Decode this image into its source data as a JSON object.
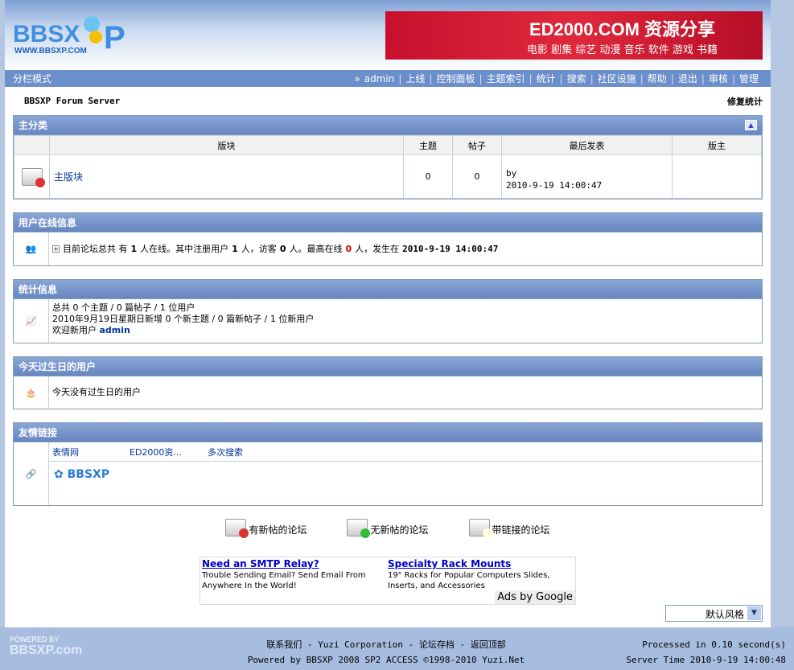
{
  "header": {
    "logo_text": "BBSXP",
    "logo_url_text": "WWW.BBSXP.COM",
    "banner_title": "ED2000.COM 资源分享",
    "banner_sub": "电影 剧集 综艺 动漫 音乐 软件 游戏 书籍"
  },
  "nav": {
    "mode": "分栏模式",
    "arrow": "»",
    "items": [
      "admin",
      "上线",
      "控制面板",
      "主题索引",
      "统计",
      "搜索",
      "社区设施",
      "帮助",
      "退出",
      "审核",
      "管理"
    ]
  },
  "sub": {
    "title": "BBSXP Forum Server",
    "repair": "修复统计"
  },
  "main_cat": {
    "title": "主分类",
    "columns": [
      "版块",
      "主题",
      "帖子",
      "最后发表",
      "版主"
    ],
    "rows": [
      {
        "name": "主版块",
        "topics": "0",
        "posts": "0",
        "last_by": "by",
        "last_time": "2010-9-19 14:00:47",
        "moderator": ""
      }
    ]
  },
  "online": {
    "title": "用户在线信息",
    "p1": "目前论坛总共 有",
    "total": "1",
    "p2": "人在线。其中注册用户",
    "reg": "1",
    "p3": "人，访客",
    "guest": "0",
    "p4": "人。最高在线",
    "max": "0",
    "p5": "人，发生在",
    "time": "2010-9-19 14:00:47"
  },
  "stats": {
    "title": "统计信息",
    "line1": "总共 0 个主题 / 0 篇帖子 / 1 位用户",
    "line2": "2010年9月19日星期日新增 0 个新主题 / 0 篇新帖子 / 1 位新用户",
    "line3_label": "欢迎新用户",
    "new_user": "admin"
  },
  "birthday": {
    "title": "今天过生日的用户",
    "text": "今天没有过生日的用户"
  },
  "links": {
    "title": "友情链接",
    "items": [
      "表情网",
      "ED2000资...",
      "多次搜索"
    ],
    "logo_text": "BBSXP"
  },
  "legend": [
    "有新帖的论坛",
    "无新帖的论坛",
    "带链接的论坛"
  ],
  "ads": [
    {
      "title": "Need an SMTP Relay?",
      "text": "Trouble Sending Email? Send Email From Anywhere In the World!"
    },
    {
      "title": "Specialty Rack Mounts",
      "text": "19\" Racks for Popular Computers Slides, Inserts, and Accessories"
    }
  ],
  "ads_by": "Ads by Google",
  "style_select": "默认风格",
  "footer": {
    "powered_small": "POWERED BY",
    "powered_big": "BBSXP.com",
    "links": "联系我们 - Yuzi Corporation - 论坛存档 - 返回顶部",
    "powered": "Powered by BBSXP 2008 SP2 ACCESS ©1998-2010 Yuzi.Net",
    "processed": "Processed in 0.10 second(s)",
    "server_time": "Server Time 2010-9-19 14:00:48"
  },
  "colors": {
    "nav": "#6b8fcb",
    "footer": "#a7bde0",
    "border": "#7f9db9"
  }
}
